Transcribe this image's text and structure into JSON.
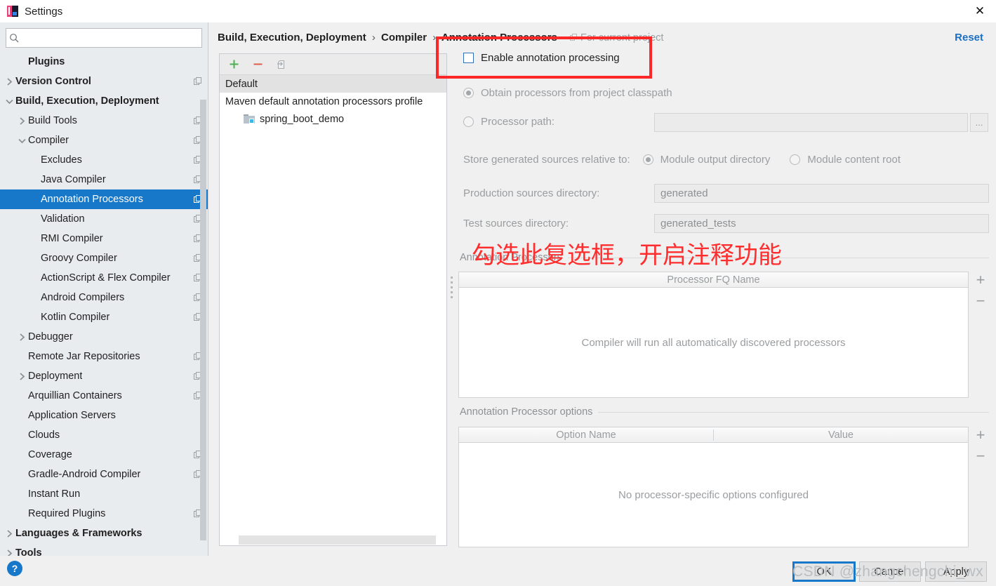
{
  "window": {
    "title": "Settings",
    "app_icon": "intellij-idea-icon",
    "close_icon": "close-icon"
  },
  "sidebar": {
    "search": {
      "placeholder": "",
      "value": "",
      "icon": "search-icon"
    },
    "items": [
      {
        "label": "Plugins",
        "indent": 1,
        "arrow": "none",
        "bold": true,
        "badge": false,
        "selected": false
      },
      {
        "label": "Version Control",
        "indent": 0,
        "arrow": "right",
        "bold": true,
        "badge": true,
        "selected": false
      },
      {
        "label": "Build, Execution, Deployment",
        "indent": 0,
        "arrow": "down",
        "bold": true,
        "badge": false,
        "selected": false
      },
      {
        "label": "Build Tools",
        "indent": 1,
        "arrow": "right",
        "bold": false,
        "badge": true,
        "selected": false
      },
      {
        "label": "Compiler",
        "indent": 1,
        "arrow": "down",
        "bold": false,
        "badge": true,
        "selected": false
      },
      {
        "label": "Excludes",
        "indent": 2,
        "arrow": "none",
        "bold": false,
        "badge": true,
        "selected": false
      },
      {
        "label": "Java Compiler",
        "indent": 2,
        "arrow": "none",
        "bold": false,
        "badge": true,
        "selected": false
      },
      {
        "label": "Annotation Processors",
        "indent": 2,
        "arrow": "none",
        "bold": false,
        "badge": true,
        "selected": true
      },
      {
        "label": "Validation",
        "indent": 2,
        "arrow": "none",
        "bold": false,
        "badge": true,
        "selected": false
      },
      {
        "label": "RMI Compiler",
        "indent": 2,
        "arrow": "none",
        "bold": false,
        "badge": true,
        "selected": false
      },
      {
        "label": "Groovy Compiler",
        "indent": 2,
        "arrow": "none",
        "bold": false,
        "badge": true,
        "selected": false
      },
      {
        "label": "ActionScript & Flex Compiler",
        "indent": 2,
        "arrow": "none",
        "bold": false,
        "badge": true,
        "selected": false
      },
      {
        "label": "Android Compilers",
        "indent": 2,
        "arrow": "none",
        "bold": false,
        "badge": true,
        "selected": false
      },
      {
        "label": "Kotlin Compiler",
        "indent": 2,
        "arrow": "none",
        "bold": false,
        "badge": true,
        "selected": false
      },
      {
        "label": "Debugger",
        "indent": 1,
        "arrow": "right",
        "bold": false,
        "badge": false,
        "selected": false
      },
      {
        "label": "Remote Jar Repositories",
        "indent": 1,
        "arrow": "none",
        "bold": false,
        "badge": true,
        "selected": false
      },
      {
        "label": "Deployment",
        "indent": 1,
        "arrow": "right",
        "bold": false,
        "badge": true,
        "selected": false
      },
      {
        "label": "Arquillian Containers",
        "indent": 1,
        "arrow": "none",
        "bold": false,
        "badge": true,
        "selected": false
      },
      {
        "label": "Application Servers",
        "indent": 1,
        "arrow": "none",
        "bold": false,
        "badge": false,
        "selected": false
      },
      {
        "label": "Clouds",
        "indent": 1,
        "arrow": "none",
        "bold": false,
        "badge": false,
        "selected": false
      },
      {
        "label": "Coverage",
        "indent": 1,
        "arrow": "none",
        "bold": false,
        "badge": true,
        "selected": false
      },
      {
        "label": "Gradle-Android Compiler",
        "indent": 1,
        "arrow": "none",
        "bold": false,
        "badge": true,
        "selected": false
      },
      {
        "label": "Instant Run",
        "indent": 1,
        "arrow": "none",
        "bold": false,
        "badge": false,
        "selected": false
      },
      {
        "label": "Required Plugins",
        "indent": 1,
        "arrow": "none",
        "bold": false,
        "badge": true,
        "selected": false
      },
      {
        "label": "Languages & Frameworks",
        "indent": 0,
        "arrow": "right",
        "bold": true,
        "badge": false,
        "selected": false
      },
      {
        "label": "Tools",
        "indent": 0,
        "arrow": "right",
        "bold": true,
        "badge": false,
        "selected": false
      }
    ]
  },
  "header": {
    "crumb1": "Build, Execution, Deployment",
    "crumb2": "Compiler",
    "crumb3": "Annotation Processors",
    "separator": "›",
    "scope_label": "For current project",
    "scope_icon": "project-scope-icon",
    "reset_label": "Reset"
  },
  "profiles": {
    "toolbar": [
      {
        "name": "add-profile-button",
        "icon": "plus-icon",
        "glyph": "+",
        "color": "#4caf50"
      },
      {
        "name": "remove-profile-button",
        "icon": "minus-icon",
        "glyph": "–",
        "color": "#e05a4f"
      },
      {
        "name": "move-to-profile-button",
        "icon": "move-to-icon",
        "glyph": "",
        "color": "#a9adb1"
      }
    ],
    "rows": [
      {
        "label": "Default",
        "selected": true,
        "module": false
      },
      {
        "label": "Maven default annotation processors profile",
        "selected": false,
        "module": false
      },
      {
        "label": "spring_boot_demo",
        "selected": false,
        "module": true
      }
    ]
  },
  "detail": {
    "enable_checkbox": {
      "label": "Enable annotation processing",
      "checked": false
    },
    "source_radios": [
      {
        "label": "Obtain processors from project classpath",
        "checked": true
      },
      {
        "label": "Processor path:",
        "checked": false
      }
    ],
    "processor_path_value": "",
    "processor_path_browse": "...",
    "store_relative_label": "Store generated sources relative to:",
    "store_relative_options": [
      {
        "label": "Module output directory",
        "checked": true
      },
      {
        "label": "Module content root",
        "checked": false
      }
    ],
    "production_sources_label": "Production sources directory:",
    "production_sources_value": "generated",
    "test_sources_label": "Test sources directory:",
    "test_sources_value": "generated_tests",
    "processors_group_title": "Annotation Processors",
    "processors_table": {
      "columns": [
        "Processor FQ Name"
      ],
      "empty_text": "Compiler will run all automatically discovered processors",
      "rows": []
    },
    "options_group_title": "Annotation Processor options",
    "options_table": {
      "columns": [
        "Option Name",
        "Value"
      ],
      "empty_text": "No processor-specific options configured",
      "rows": []
    },
    "table_add_glyph": "+",
    "table_remove_glyph": "−"
  },
  "annotation": {
    "note_text": "勾选此复选框，开启注释功能",
    "note_color": "#ff2d2d",
    "box_color": "#fc2828"
  },
  "footer": {
    "help_glyph": "?",
    "ok_label": "OK",
    "cancel_label": "Cancel",
    "apply_label": "Apply",
    "watermark": "CSDN @zhangchengchi_wx"
  }
}
